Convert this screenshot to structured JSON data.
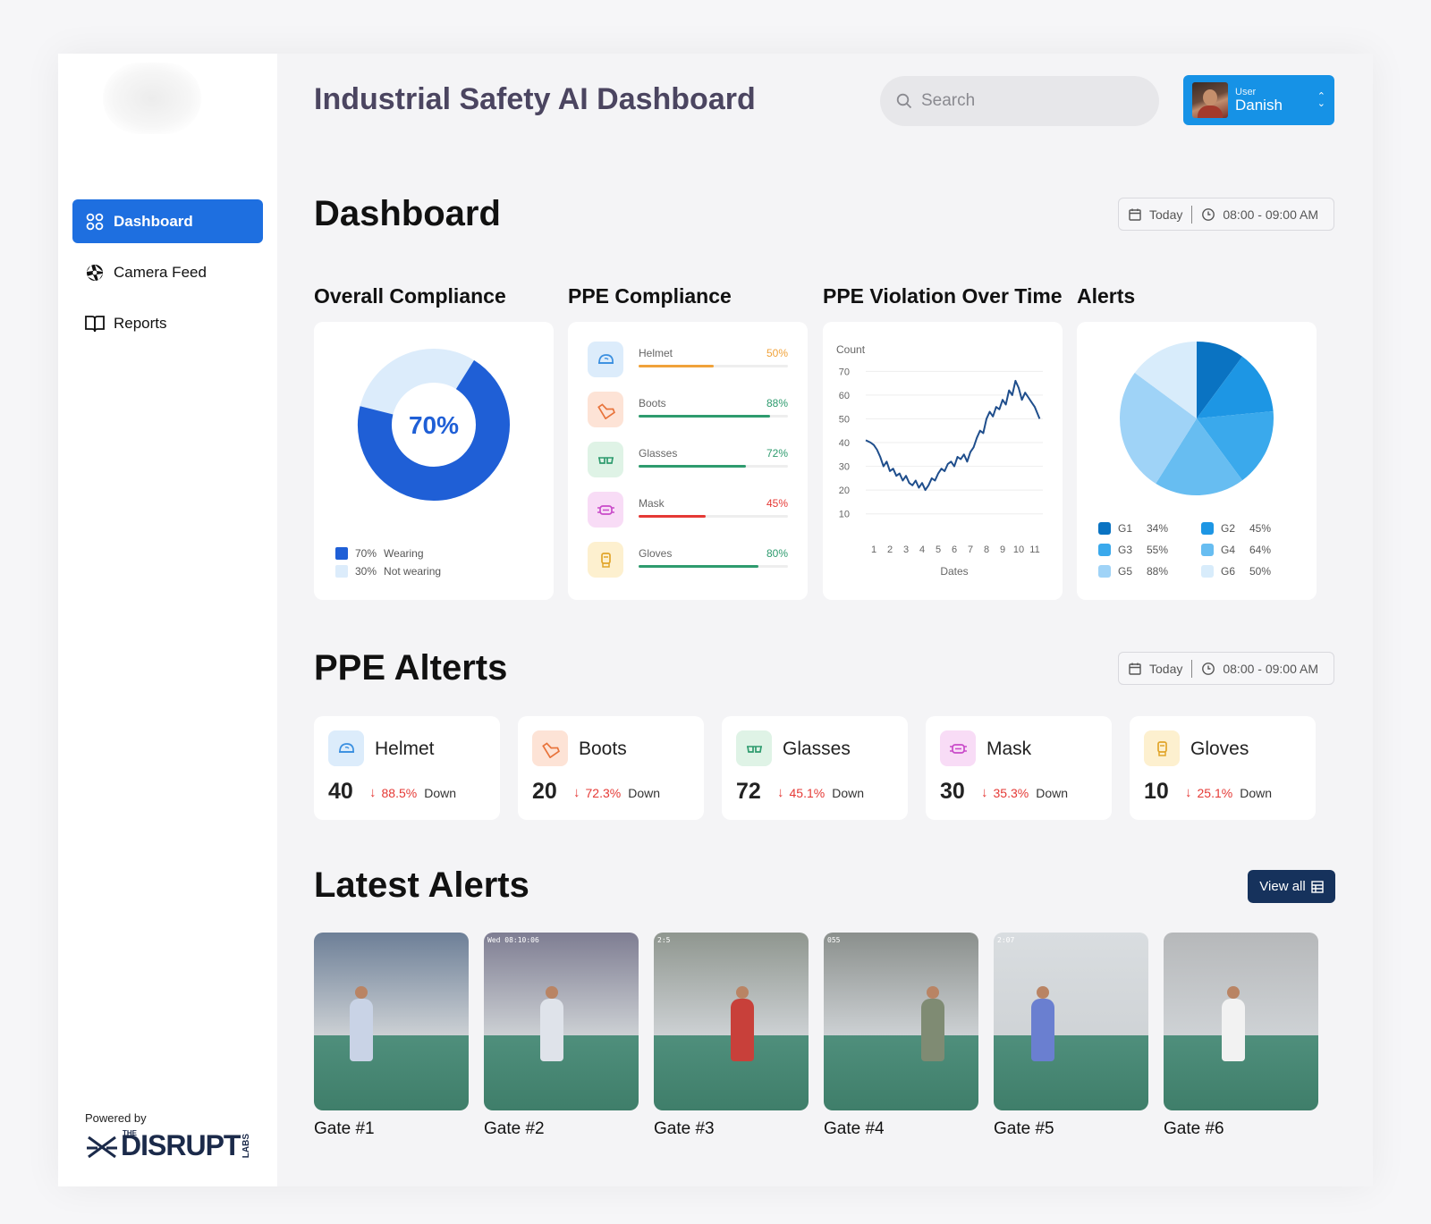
{
  "app": {
    "title": "Industrial Safety AI Dashboard"
  },
  "search": {
    "placeholder": "Search"
  },
  "user": {
    "role": "User",
    "name": "Danish"
  },
  "sidebar": {
    "items": [
      {
        "label": "Dashboard",
        "icon": "grid-icon",
        "active": true
      },
      {
        "label": "Camera Feed",
        "icon": "aperture-icon",
        "active": false
      },
      {
        "label": "Reports",
        "icon": "book-icon",
        "active": false
      }
    ],
    "powered_by": "Powered by",
    "brand": {
      "the": "THE",
      "word": "DISRUPT",
      "labs": "LABS"
    }
  },
  "dashboard": {
    "title": "Dashboard",
    "date": "Today",
    "time": "08:00 - 09:00 AM"
  },
  "overall_compliance": {
    "title": "Overall Compliance",
    "center_label": "70%",
    "legend": [
      {
        "pct": "70%",
        "label": "Wearing",
        "color": "#1f5fd6"
      },
      {
        "pct": "30%",
        "label": "Not wearing",
        "color": "#dcecfb"
      }
    ]
  },
  "ppe_compliance": {
    "title": "PPE Compliance",
    "items": [
      {
        "name": "Helmet",
        "pct": "50%",
        "value": 50,
        "color": "#f0a23a",
        "icon_bg": "#dcecfb",
        "icon_color": "#3a8fe0",
        "icon": "helmet-icon"
      },
      {
        "name": "Boots",
        "pct": "88%",
        "value": 88,
        "color": "#2e9b6e",
        "icon_bg": "#fde3d6",
        "icon_color": "#e8733a",
        "icon": "boot-icon"
      },
      {
        "name": "Glasses",
        "pct": "72%",
        "value": 72,
        "color": "#2e9b6e",
        "icon_bg": "#dff3e6",
        "icon_color": "#2e9b6e",
        "icon": "glasses-icon"
      },
      {
        "name": "Mask",
        "pct": "45%",
        "value": 45,
        "color": "#e53935",
        "icon_bg": "#f8dcf6",
        "icon_color": "#c94ac9",
        "icon": "mask-icon"
      },
      {
        "name": "Gloves",
        "pct": "80%",
        "value": 80,
        "color": "#2e9b6e",
        "icon_bg": "#fdf0cf",
        "icon_color": "#e1a52a",
        "icon": "glove-icon"
      }
    ]
  },
  "violation_chart": {
    "title": "PPE Violation Over Time"
  },
  "chart_data": [
    {
      "type": "line",
      "title": "PPE Violation Over Time",
      "ylabel": "Count",
      "xlabel": "Dates",
      "x_ticks": [
        "1",
        "2",
        "3",
        "4",
        "5",
        "6",
        "7",
        "8",
        "9",
        "10",
        "11"
      ],
      "y_ticks": [
        "70",
        "60",
        "50",
        "40",
        "30",
        "20",
        "10"
      ],
      "xlim": [
        0.5,
        11.5
      ],
      "ylim": [
        5,
        72
      ],
      "grid": true,
      "color": "#1f4e8c",
      "x": [
        0.5,
        0.8,
        1.0,
        1.2,
        1.4,
        1.6,
        1.8,
        2.0,
        2.2,
        2.4,
        2.6,
        2.8,
        3.0,
        3.2,
        3.4,
        3.6,
        3.8,
        4.0,
        4.2,
        4.4,
        4.6,
        4.8,
        5.0,
        5.2,
        5.4,
        5.6,
        5.8,
        6.0,
        6.2,
        6.4,
        6.6,
        6.8,
        7.0,
        7.2,
        7.4,
        7.6,
        7.8,
        8.0,
        8.2,
        8.4,
        8.6,
        8.8,
        9.0,
        9.2,
        9.4,
        9.6,
        9.8,
        10.0,
        10.2,
        10.4,
        10.6,
        10.8,
        11.0,
        11.3
      ],
      "y": [
        41,
        40,
        39,
        37,
        34,
        30,
        32,
        28,
        29,
        26,
        27,
        24,
        26,
        23,
        22,
        24,
        21,
        23,
        20,
        22,
        25,
        24,
        27,
        29,
        28,
        31,
        32,
        30,
        34,
        33,
        35,
        32,
        36,
        38,
        42,
        45,
        44,
        50,
        53,
        51,
        55,
        54,
        58,
        56,
        62,
        60,
        66,
        63,
        58,
        61,
        59,
        57,
        55,
        50
      ]
    },
    {
      "type": "pie",
      "title": "Alerts",
      "slices": [
        {
          "label": "G1",
          "value": 34,
          "display": "34%",
          "color": "#0a73c2"
        },
        {
          "label": "G2",
          "value": 45,
          "display": "45%",
          "color": "#1d96e4"
        },
        {
          "label": "G3",
          "value": 55,
          "display": "55%",
          "color": "#3aa9ec"
        },
        {
          "label": "G4",
          "value": 64,
          "display": "64%",
          "color": "#67bdf1"
        },
        {
          "label": "G5",
          "value": 88,
          "display": "88%",
          "color": "#9fd3f7"
        },
        {
          "label": "G6",
          "value": 50,
          "display": "50%",
          "color": "#d8ecfb"
        }
      ]
    }
  ],
  "ppe_alerts": {
    "title": "PPE Alterts",
    "date": "Today",
    "time": "08:00 - 09:00 AM",
    "items": [
      {
        "name": "Helmet",
        "count": "40",
        "change": "88.5%",
        "dir": "Down",
        "icon": "helmet-icon",
        "icon_bg": "#dcecfb",
        "icon_color": "#3a8fe0"
      },
      {
        "name": "Boots",
        "count": "20",
        "change": "72.3%",
        "dir": "Down",
        "icon": "boot-icon",
        "icon_bg": "#fde3d6",
        "icon_color": "#e8733a"
      },
      {
        "name": "Glasses",
        "count": "72",
        "change": "45.1%",
        "dir": "Down",
        "icon": "glasses-icon",
        "icon_bg": "#dff3e6",
        "icon_color": "#2e9b6e"
      },
      {
        "name": "Mask",
        "count": "30",
        "change": "35.3%",
        "dir": "Down",
        "icon": "mask-icon",
        "icon_bg": "#f8dcf6",
        "icon_color": "#c94ac9"
      },
      {
        "name": "Gloves",
        "count": "10",
        "change": "25.1%",
        "dir": "Down",
        "icon": "glove-icon",
        "icon_bg": "#fdf0cf",
        "icon_color": "#e1a52a"
      }
    ]
  },
  "latest_alerts": {
    "title": "Latest Alerts",
    "view_all": "View all",
    "gates": [
      {
        "label": "Gate #1",
        "timestamp": "",
        "wall": "#6d7f97"
      },
      {
        "label": "Gate #2",
        "timestamp": "Wed 08:10:06",
        "wall": "#7e7d92"
      },
      {
        "label": "Gate #3",
        "timestamp": "2:5",
        "wall": "#8f968f"
      },
      {
        "label": "Gate #4",
        "timestamp": "055",
        "wall": "#8a8f8c"
      },
      {
        "label": "Gate #5",
        "timestamp": "2:07",
        "wall": "#d9dde0"
      },
      {
        "label": "Gate #6",
        "timestamp": "",
        "wall": "#b6b8ba"
      }
    ]
  }
}
